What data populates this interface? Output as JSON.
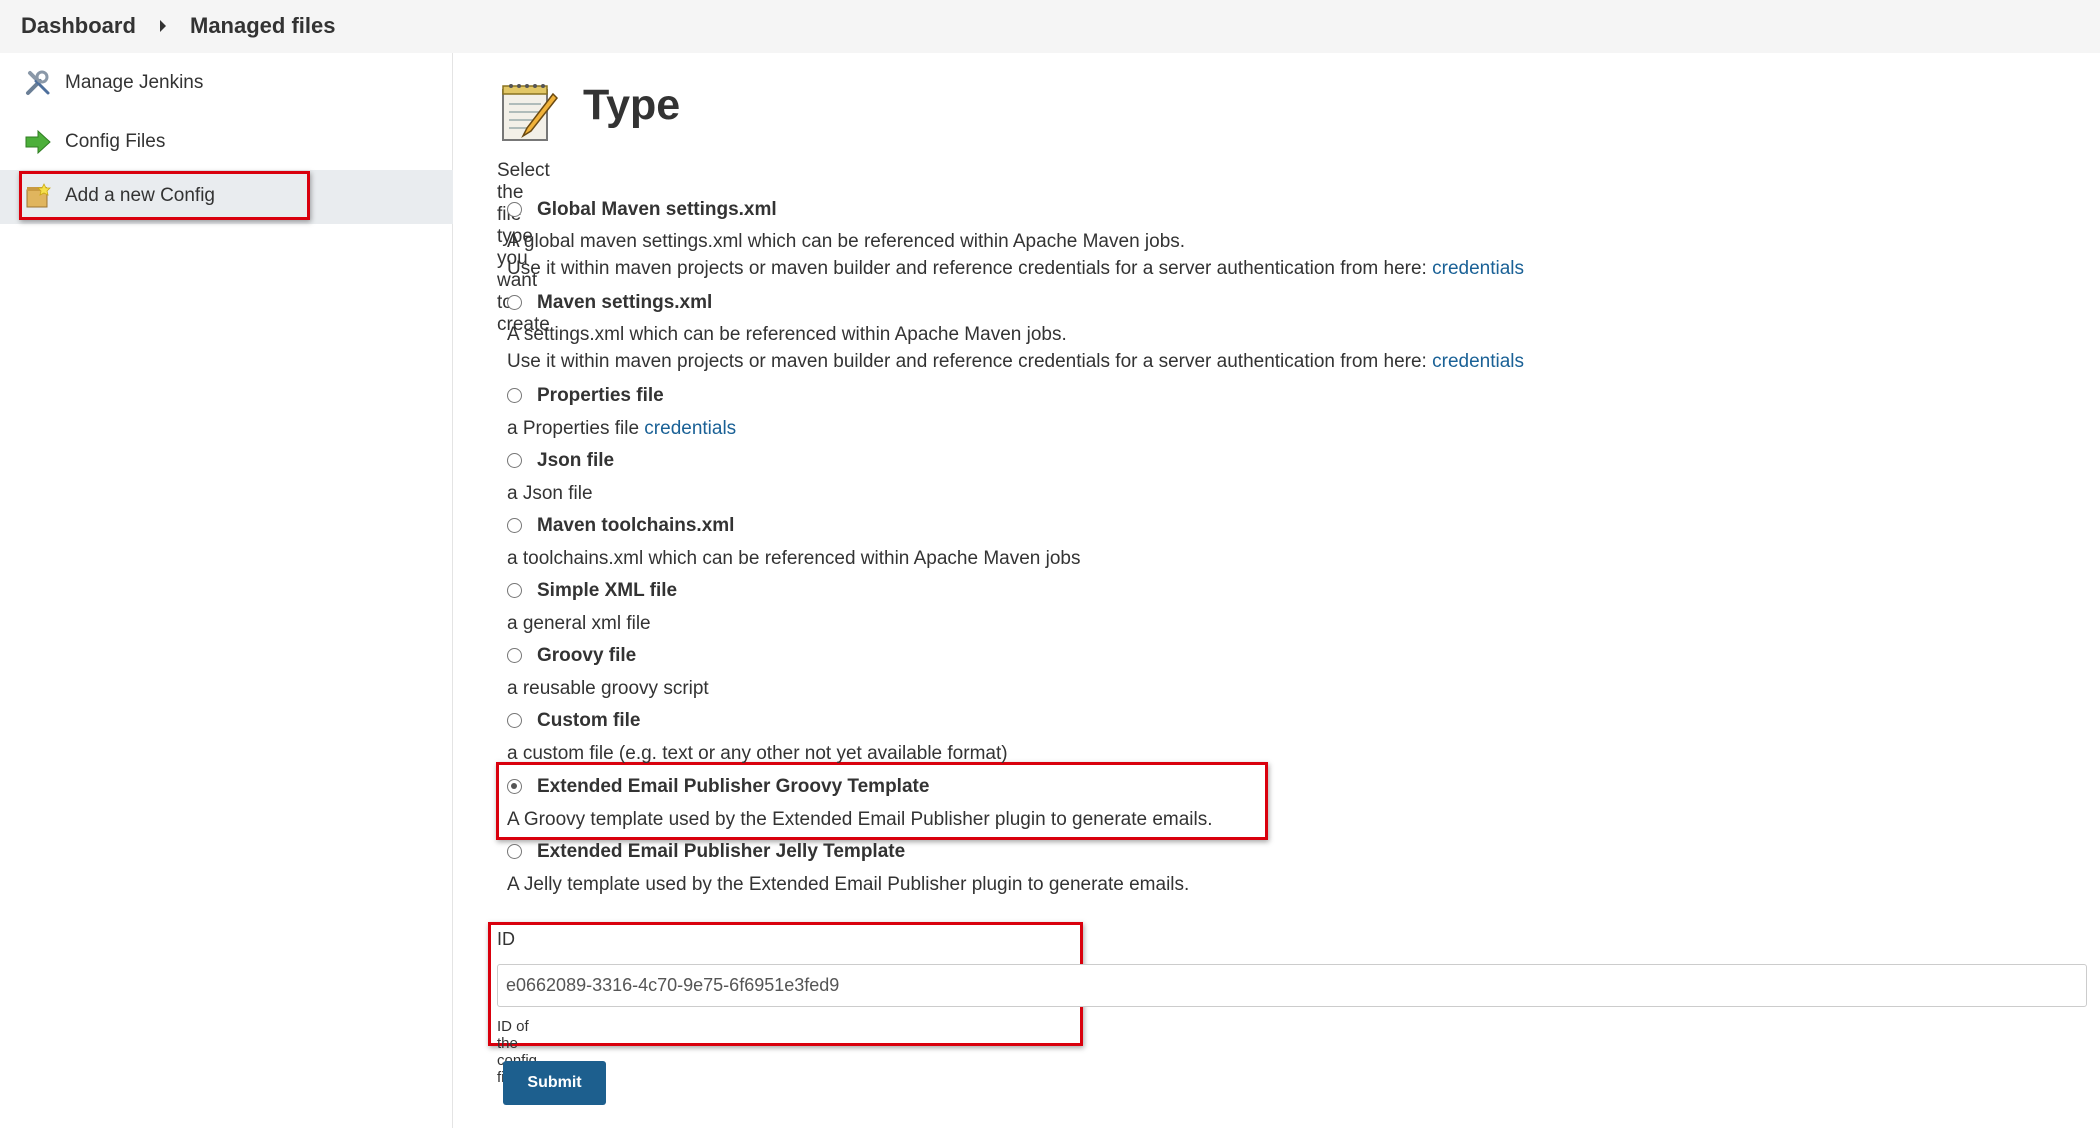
{
  "breadcrumb": {
    "dashboard": "Dashboard",
    "managed_files": "Managed files"
  },
  "sidebar": {
    "items": [
      {
        "label": "Manage Jenkins",
        "icon": "tools-icon"
      },
      {
        "label": "Config Files",
        "icon": "green-arrow-icon"
      },
      {
        "label": "Add a new Config",
        "icon": "new-config-icon"
      }
    ]
  },
  "main": {
    "title": "Type",
    "subtitle": "Select the file type you want to create",
    "options": [
      {
        "label": "Global Maven settings.xml",
        "desc": "A global maven settings.xml which can be referenced within Apache Maven jobs.",
        "desc2": "Use it within maven projects or maven builder and reference credentials for a server authentication from here: ",
        "link": "credentials",
        "checked": false
      },
      {
        "label": "Maven settings.xml",
        "desc": "A settings.xml which can be referenced within Apache Maven jobs.",
        "desc2": "Use it within maven projects or maven builder and reference credentials for a server authentication from here: ",
        "link": "credentials",
        "checked": false
      },
      {
        "label": "Properties file",
        "desc": "a Properties file ",
        "link": "credentials",
        "checked": false
      },
      {
        "label": "Json file",
        "desc": "a Json file",
        "checked": false
      },
      {
        "label": "Maven toolchains.xml",
        "desc": "a toolchains.xml which can be referenced within Apache Maven jobs",
        "checked": false
      },
      {
        "label": "Simple XML file",
        "desc": "a general xml file",
        "checked": false
      },
      {
        "label": "Groovy file",
        "desc": "a reusable groovy script",
        "checked": false
      },
      {
        "label": "Custom file",
        "desc": "a custom file (e.g. text or any other not yet available format)",
        "checked": false
      },
      {
        "label": "Extended Email Publisher Groovy Template",
        "desc": "A Groovy template used by the Extended Email Publisher plugin to generate emails.",
        "checked": true
      },
      {
        "label": "Extended Email Publisher Jelly Template",
        "desc": "A Jelly template used by the Extended Email Publisher plugin to generate emails.",
        "checked": false
      }
    ],
    "id_label": "ID",
    "id_value": "e0662089-3316-4c70-9e75-6f6951e3fed9",
    "id_help": "ID of the config file",
    "submit_label": "Submit"
  },
  "colors": {
    "highlight": "#d9000d",
    "link": "#1a6196",
    "button": "#1d5f8e"
  }
}
